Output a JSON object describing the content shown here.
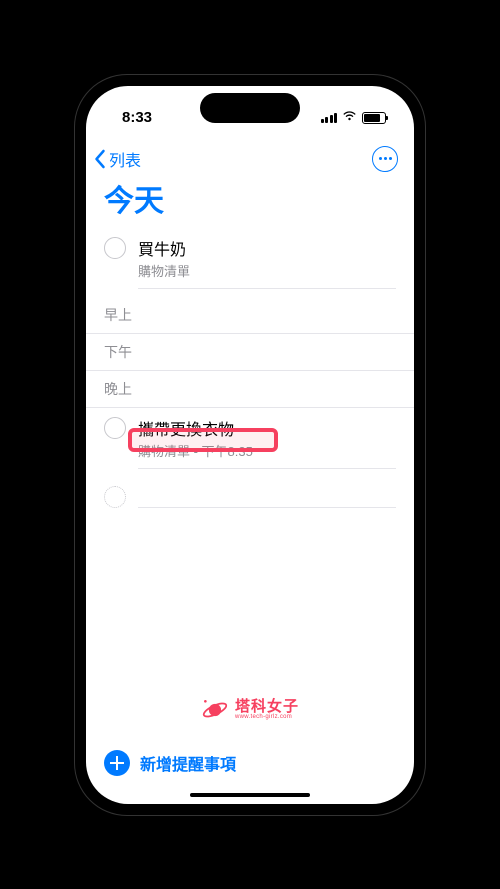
{
  "status": {
    "time": "8:33"
  },
  "nav": {
    "back": "列表"
  },
  "title": "今天",
  "reminders": {
    "untimed": {
      "title": "買牛奶",
      "sub": "購物清單"
    },
    "evening": {
      "title": "攜帶更換衣物",
      "sub": "購物清單 - 下午8:35"
    }
  },
  "sections": {
    "morning": "早上",
    "afternoon": "下午",
    "evening": "晚上"
  },
  "watermark": {
    "main": "塔科女子",
    "sub": "www.tech-girlz.com"
  },
  "bottom": {
    "add": "新增提醒事項"
  }
}
